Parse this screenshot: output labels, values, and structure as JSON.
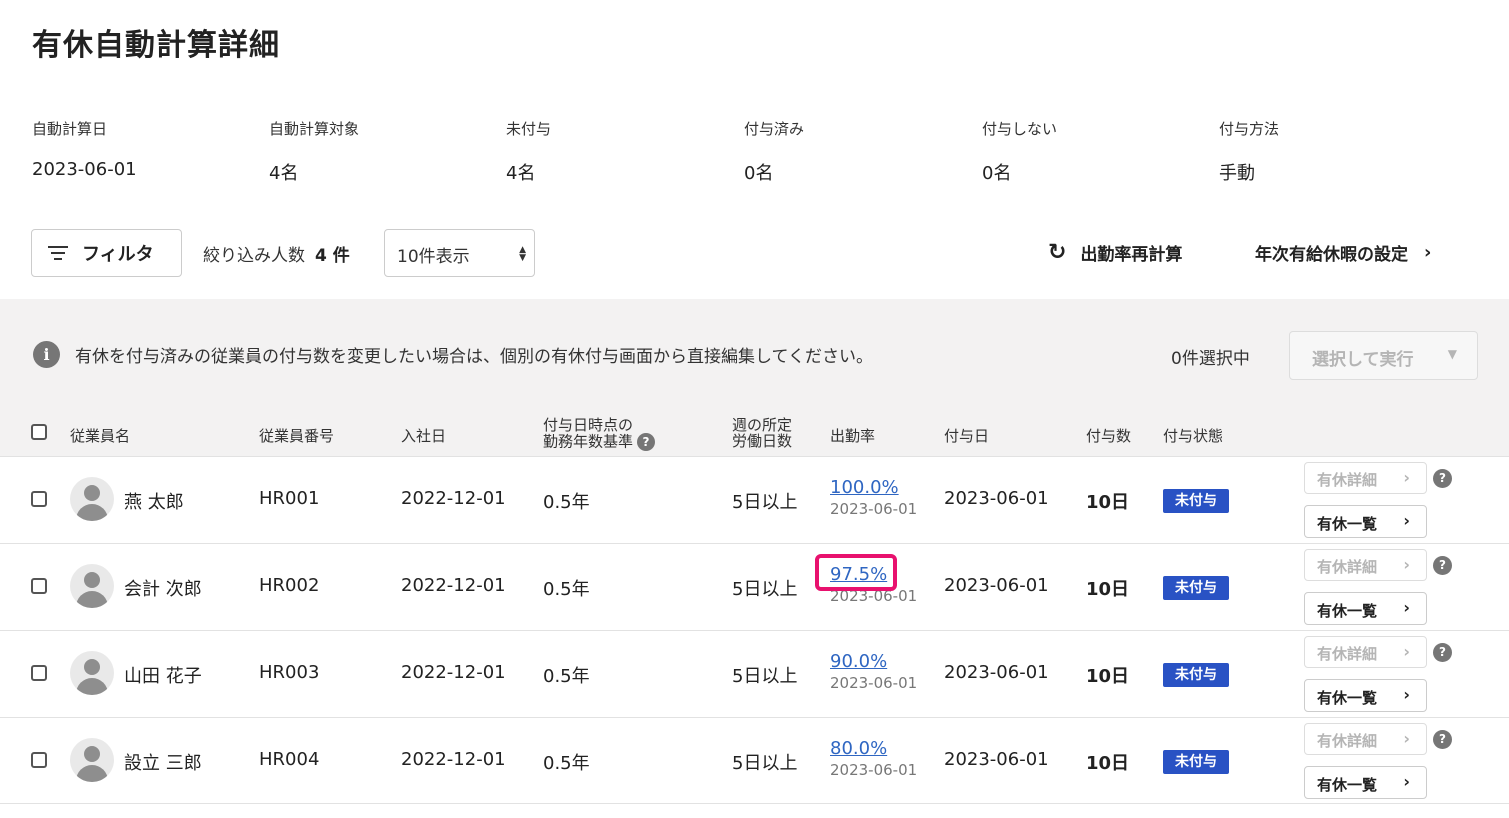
{
  "page": {
    "title": "有休自動計算詳細"
  },
  "summary": [
    {
      "label": "自動計算日",
      "value": "2023-06-01"
    },
    {
      "label": "自動計算対象",
      "value": "4名"
    },
    {
      "label": "未付与",
      "value": "4名"
    },
    {
      "label": "付与済み",
      "value": "0名"
    },
    {
      "label": "付与しない",
      "value": "0名"
    },
    {
      "label": "付与方法",
      "value": "手動"
    }
  ],
  "toolbar": {
    "filter_label": "フィルタ",
    "count_label": "絞り込み人数",
    "count_value": "4 件",
    "page_size": "10件表示",
    "recalc_label": "出勤率再計算",
    "settings_label": "年次有給休暇の設定"
  },
  "notice": {
    "text": "有休を付与済みの従業員の付与数を変更したい場合は、個別の有休付与画面から直接編集してください。",
    "selected_count": "0件選択中",
    "execute_label": "選択して実行"
  },
  "table": {
    "headers": {
      "name": "従業員名",
      "number": "従業員番号",
      "hire_date": "入社日",
      "years_line1": "付与日時点の",
      "years_line2": "勤務年数基準",
      "days_line1": "週の所定",
      "days_line2": "労働日数",
      "rate": "出勤率",
      "grant_date": "付与日",
      "grant_count": "付与数",
      "status": "付与状態"
    },
    "rows": [
      {
        "name": "燕 太郎",
        "number": "HR001",
        "hire_date": "2022-12-01",
        "years": "0.5年",
        "days": "5日以上",
        "rate": "100.0%",
        "rate_date": "2023-06-01",
        "grant_date": "2023-06-01",
        "grant_count": "10日",
        "status": "未付与",
        "detail_label": "有休詳細",
        "list_label": "有休一覧"
      },
      {
        "name": "会計 次郎",
        "number": "HR002",
        "hire_date": "2022-12-01",
        "years": "0.5年",
        "days": "5日以上",
        "rate": "97.5%",
        "rate_date": "2023-06-01",
        "grant_date": "2023-06-01",
        "grant_count": "10日",
        "status": "未付与",
        "detail_label": "有休詳細",
        "list_label": "有休一覧"
      },
      {
        "name": "山田 花子",
        "number": "HR003",
        "hire_date": "2022-12-01",
        "years": "0.5年",
        "days": "5日以上",
        "rate": "90.0%",
        "rate_date": "2023-06-01",
        "grant_date": "2023-06-01",
        "grant_count": "10日",
        "status": "未付与",
        "detail_label": "有休詳細",
        "list_label": "有休一覧"
      },
      {
        "name": "設立 三郎",
        "number": "HR004",
        "hire_date": "2022-12-01",
        "years": "0.5年",
        "days": "5日以上",
        "rate": "80.0%",
        "rate_date": "2023-06-01",
        "grant_date": "2023-06-01",
        "grant_count": "10日",
        "status": "未付与",
        "detail_label": "有休詳細",
        "list_label": "有休一覧"
      }
    ]
  },
  "colors": {
    "accent_link": "#2f66c2",
    "status_badge": "#2952c4",
    "highlight": "#e8116e"
  }
}
